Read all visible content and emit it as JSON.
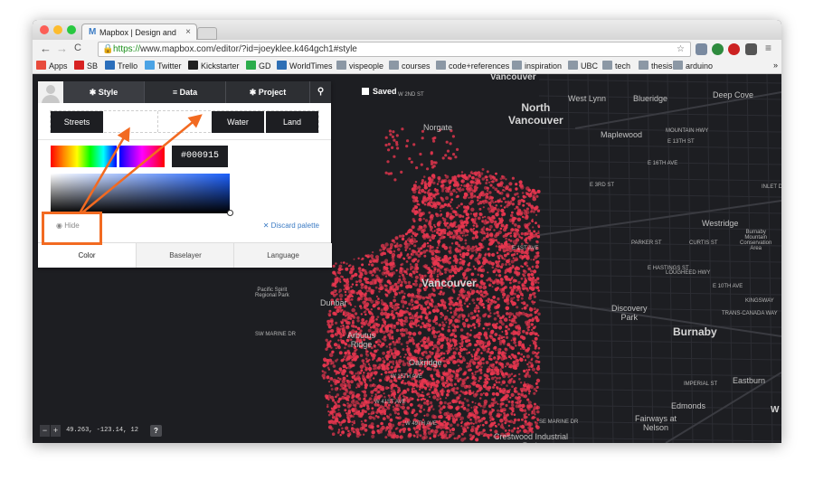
{
  "browser": {
    "tab_title": "Mapbox | Design and publish",
    "tab_favicon": "M",
    "tab_close": "×",
    "url_protocol": "https://",
    "url_rest": "www.mapbox.com/editor/?id=joeyklee.k464gch1#style",
    "nav": {
      "back": "←",
      "forward": "→",
      "reload": "C"
    },
    "menu_icon": "≡",
    "bookmarks_overflow": "»"
  },
  "bookmarks": [
    {
      "label": "Apps",
      "color": "#e84b3c"
    },
    {
      "label": "SB",
      "color": "#d72222"
    },
    {
      "label": "Trello",
      "color": "#2a6ebb"
    },
    {
      "label": "Twitter",
      "color": "#4ba3e5"
    },
    {
      "label": "Kickstarter",
      "color": "#1f1f1f"
    },
    {
      "label": "GD",
      "color": "#2bac4b"
    },
    {
      "label": "WorldTimes",
      "color": "#2e6fb5"
    },
    {
      "label": "vispeople",
      "color": "#8c98a5"
    },
    {
      "label": "courses",
      "color": "#8c98a5"
    },
    {
      "label": "code+references",
      "color": "#8c98a5"
    },
    {
      "label": "inspiration",
      "color": "#8c98a5"
    },
    {
      "label": "UBC",
      "color": "#8c98a5"
    },
    {
      "label": "tech",
      "color": "#8c98a5"
    },
    {
      "label": "thesis",
      "color": "#8c98a5"
    },
    {
      "label": "arduino",
      "color": "#8c98a5"
    }
  ],
  "editor": {
    "tabs": {
      "style": "Style",
      "data": "Data",
      "project": "Project"
    },
    "saved": "Saved",
    "swatches": {
      "streets": "Streets",
      "water": "Water",
      "land": "Land"
    },
    "hex": "#000915",
    "hide": "Hide",
    "discard": "Discard palette",
    "bottom_tabs": {
      "color": "Color",
      "baselayer": "Baselayer",
      "language": "Language"
    }
  },
  "map": {
    "coords": "49.263, -123.14, 12",
    "zoom_out": "−",
    "zoom_in": "+",
    "help": "?",
    "point_color": "#e8364f",
    "background": "#1d1e22",
    "labels": {
      "north_vancouver": "North\nVancouver",
      "vancouver_top": "Vancouver",
      "west_lynn": "West Lynn",
      "blueridge": "Blueridge",
      "deep_cove": "Deep Cove",
      "norgate": "Norgate",
      "maplewood": "Maplewood",
      "westridge": "Westridge",
      "burnaby_mountain": "Burnaby\nMountain\nConservation\nArea",
      "vancouver": "Vancouver",
      "pacific_spirit": "Pacific Spirit\nRegional Park",
      "discovery_park": "Discovery\nPark",
      "burnaby": "Burnaby",
      "edmonds": "Edmonds",
      "eastburn": "Eastburn",
      "fairways": "Fairways at\nNelson",
      "crestwood": "Crestwood Industrial\nPark",
      "dunbar": "Dunbar",
      "arbutus": "Arbutus\nRidge",
      "oakridge": "Oakridge",
      "e1st": "E 1ST AVE",
      "hastings": "E HASTINGS ST",
      "lougheed": "LOUGHEED HWY",
      "canada_way": "TRANS-CANADA WAY",
      "kingsway": "KINGSWAY",
      "marine": "SW MARINE DR",
      "parker": "PARKER ST",
      "curtis": "CURTIS ST",
      "e10th": "E 10TH AVE",
      "imperial": "IMPERIAL ST",
      "e16th": "E 16TH AVE",
      "e3rd": "E 3RD ST",
      "w16th": "W 16TH AVE",
      "w41st": "W 41ST AVE",
      "w49th": "W 49TH AVE",
      "se_marine": "SE MARINE DR",
      "w2nd": "W 2ND ST",
      "e13th": "E 13TH ST",
      "inlet": "INLET DR",
      "mtn_hwy": "MOUNTAIN HWY",
      "w": "W"
    }
  }
}
